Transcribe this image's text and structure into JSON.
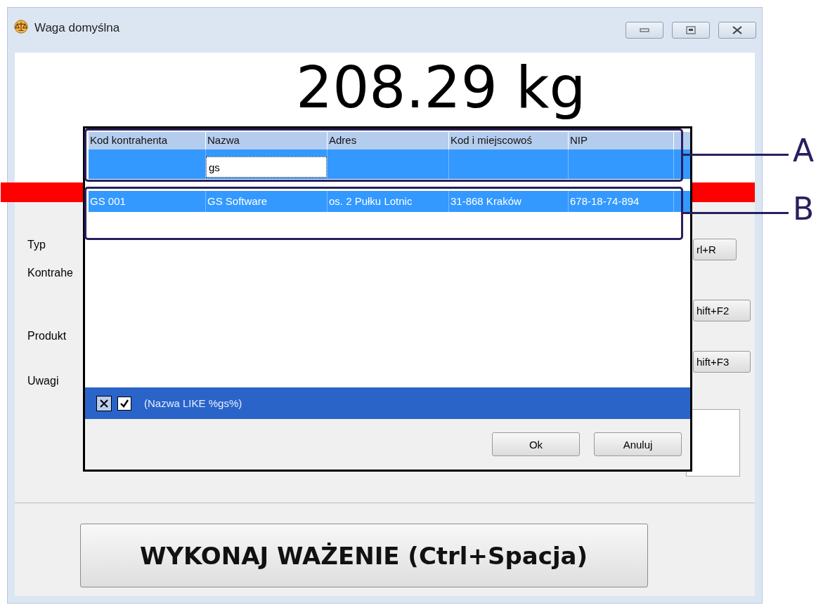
{
  "window": {
    "title": "Waga domyślna"
  },
  "display": {
    "reading": "208.29 kg"
  },
  "form": {
    "labels": [
      "Typ",
      "Kontrahe",
      "Produkt",
      "Uwagi"
    ],
    "shortcut_buttons": [
      "rl+R",
      "hift+F2",
      "hift+F3"
    ]
  },
  "weigh_button": "WYKONAJ WAŻENIE (Ctrl+Spacja)",
  "dialog": {
    "columns": [
      {
        "label": "Kod kontrahenta"
      },
      {
        "label": "Nazwa",
        "filter_value": "gs"
      },
      {
        "label": "Adres"
      },
      {
        "label": "Kod i miejscowoś"
      },
      {
        "label": "NIP"
      }
    ],
    "rows": [
      {
        "selected": true,
        "cells": [
          "GS 001",
          "GS Software",
          "os. 2 Pułku Lotnic",
          "31-868 Kraków",
          "678-18-74-894"
        ]
      }
    ],
    "filter_bar": {
      "checked": true,
      "text": "(Nazwa LIKE %gs%)"
    },
    "buttons": [
      "Ok",
      "Anuluj"
    ]
  },
  "annotations": [
    {
      "letter": "A"
    },
    {
      "letter": "B"
    }
  ]
}
